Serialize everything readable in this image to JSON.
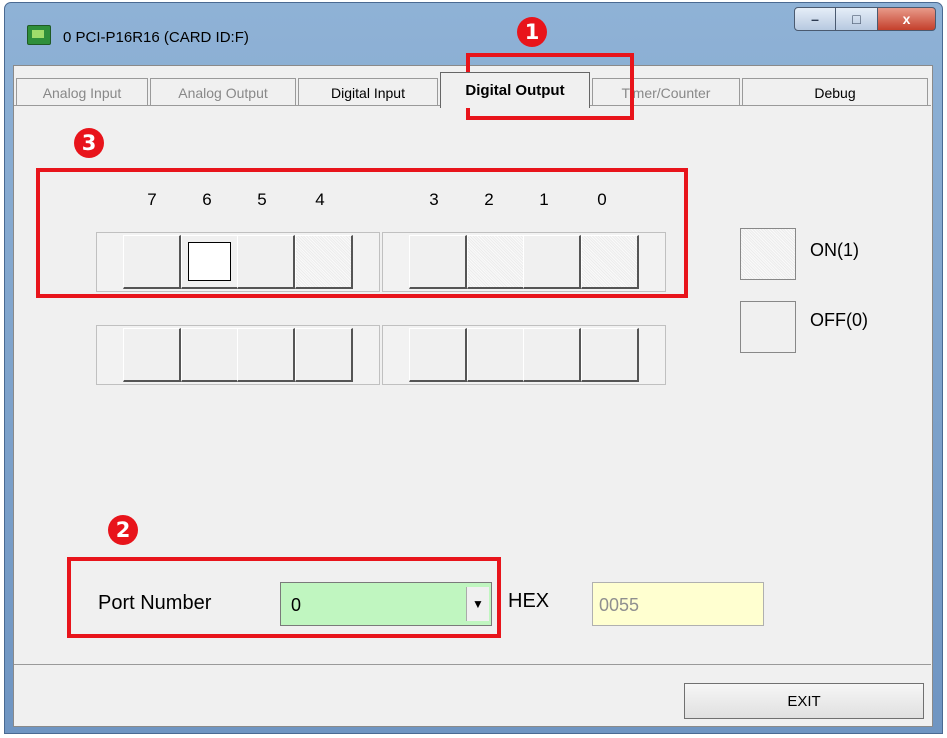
{
  "window": {
    "title": "0 PCI-P16R16 (CARD ID:F)",
    "icon": "card-icon",
    "caption_buttons": {
      "minimize": "–",
      "maximize": "□",
      "close": "x"
    }
  },
  "tabs": [
    {
      "label": "Analog Input",
      "state": "disabled"
    },
    {
      "label": "Analog Output",
      "state": "disabled"
    },
    {
      "label": "Digital Input",
      "state": "normal"
    },
    {
      "label": "Digital Output",
      "state": "active"
    },
    {
      "label": "Timer/Counter",
      "state": "disabled"
    },
    {
      "label": "Debug",
      "state": "normal"
    }
  ],
  "digital_output": {
    "bit_labels": [
      "7",
      "6",
      "5",
      "4",
      "3",
      "2",
      "1",
      "0"
    ],
    "row1_bits_on": [
      false,
      false,
      false,
      true,
      false,
      true,
      false,
      true
    ],
    "row2_bits_on": [
      false,
      false,
      false,
      false,
      false,
      false,
      false,
      false
    ],
    "legend": {
      "on_label": "ON(1)",
      "off_label": "OFF(0)"
    }
  },
  "port": {
    "label": "Port Number",
    "value": "0",
    "hex_label": "HEX",
    "hex_value": "0055"
  },
  "exit_label": "EXIT",
  "annotations": {
    "badge1": "1",
    "badge2": "2",
    "badge3": "3"
  },
  "colors": {
    "annotation_red": "#e8141b",
    "combo_bg": "#c0f6c0",
    "hex_bg": "#ffffd0"
  }
}
